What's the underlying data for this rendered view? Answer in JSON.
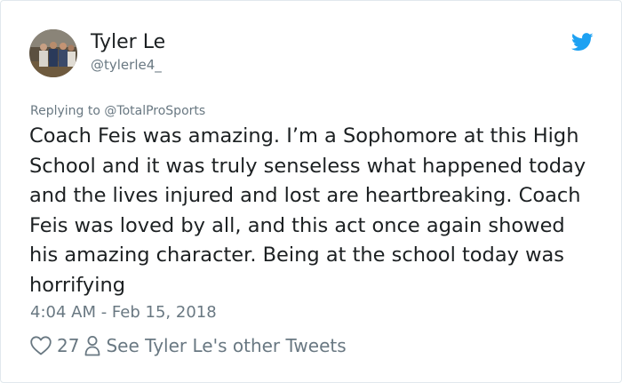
{
  "user": {
    "display_name": "Tyler Le",
    "handle": "@tylerle4_"
  },
  "reply": {
    "prefix": "Replying to",
    "mention": "@TotalProSports"
  },
  "tweet": {
    "text": "Coach Feis was amazing. I’m a Sophomore at this High School and it was truly senseless what happened today and the lives injured and lost are heartbreaking. Coach Feis was loved by all, and this act once again showed his amazing character. Being at the school today was horrifying",
    "timestamp": "4:04 AM - Feb 15, 2018"
  },
  "actions": {
    "like_count": "27",
    "profile_link": "See Tyler Le's other Tweets"
  },
  "icons": {
    "logo": "twitter-bird-icon",
    "like": "heart-icon",
    "profile": "person-icon"
  },
  "colors": {
    "twitter_blue": "#1da1f2",
    "text": "#1c2022",
    "secondary": "#697882",
    "border": "#e1e8ed"
  }
}
